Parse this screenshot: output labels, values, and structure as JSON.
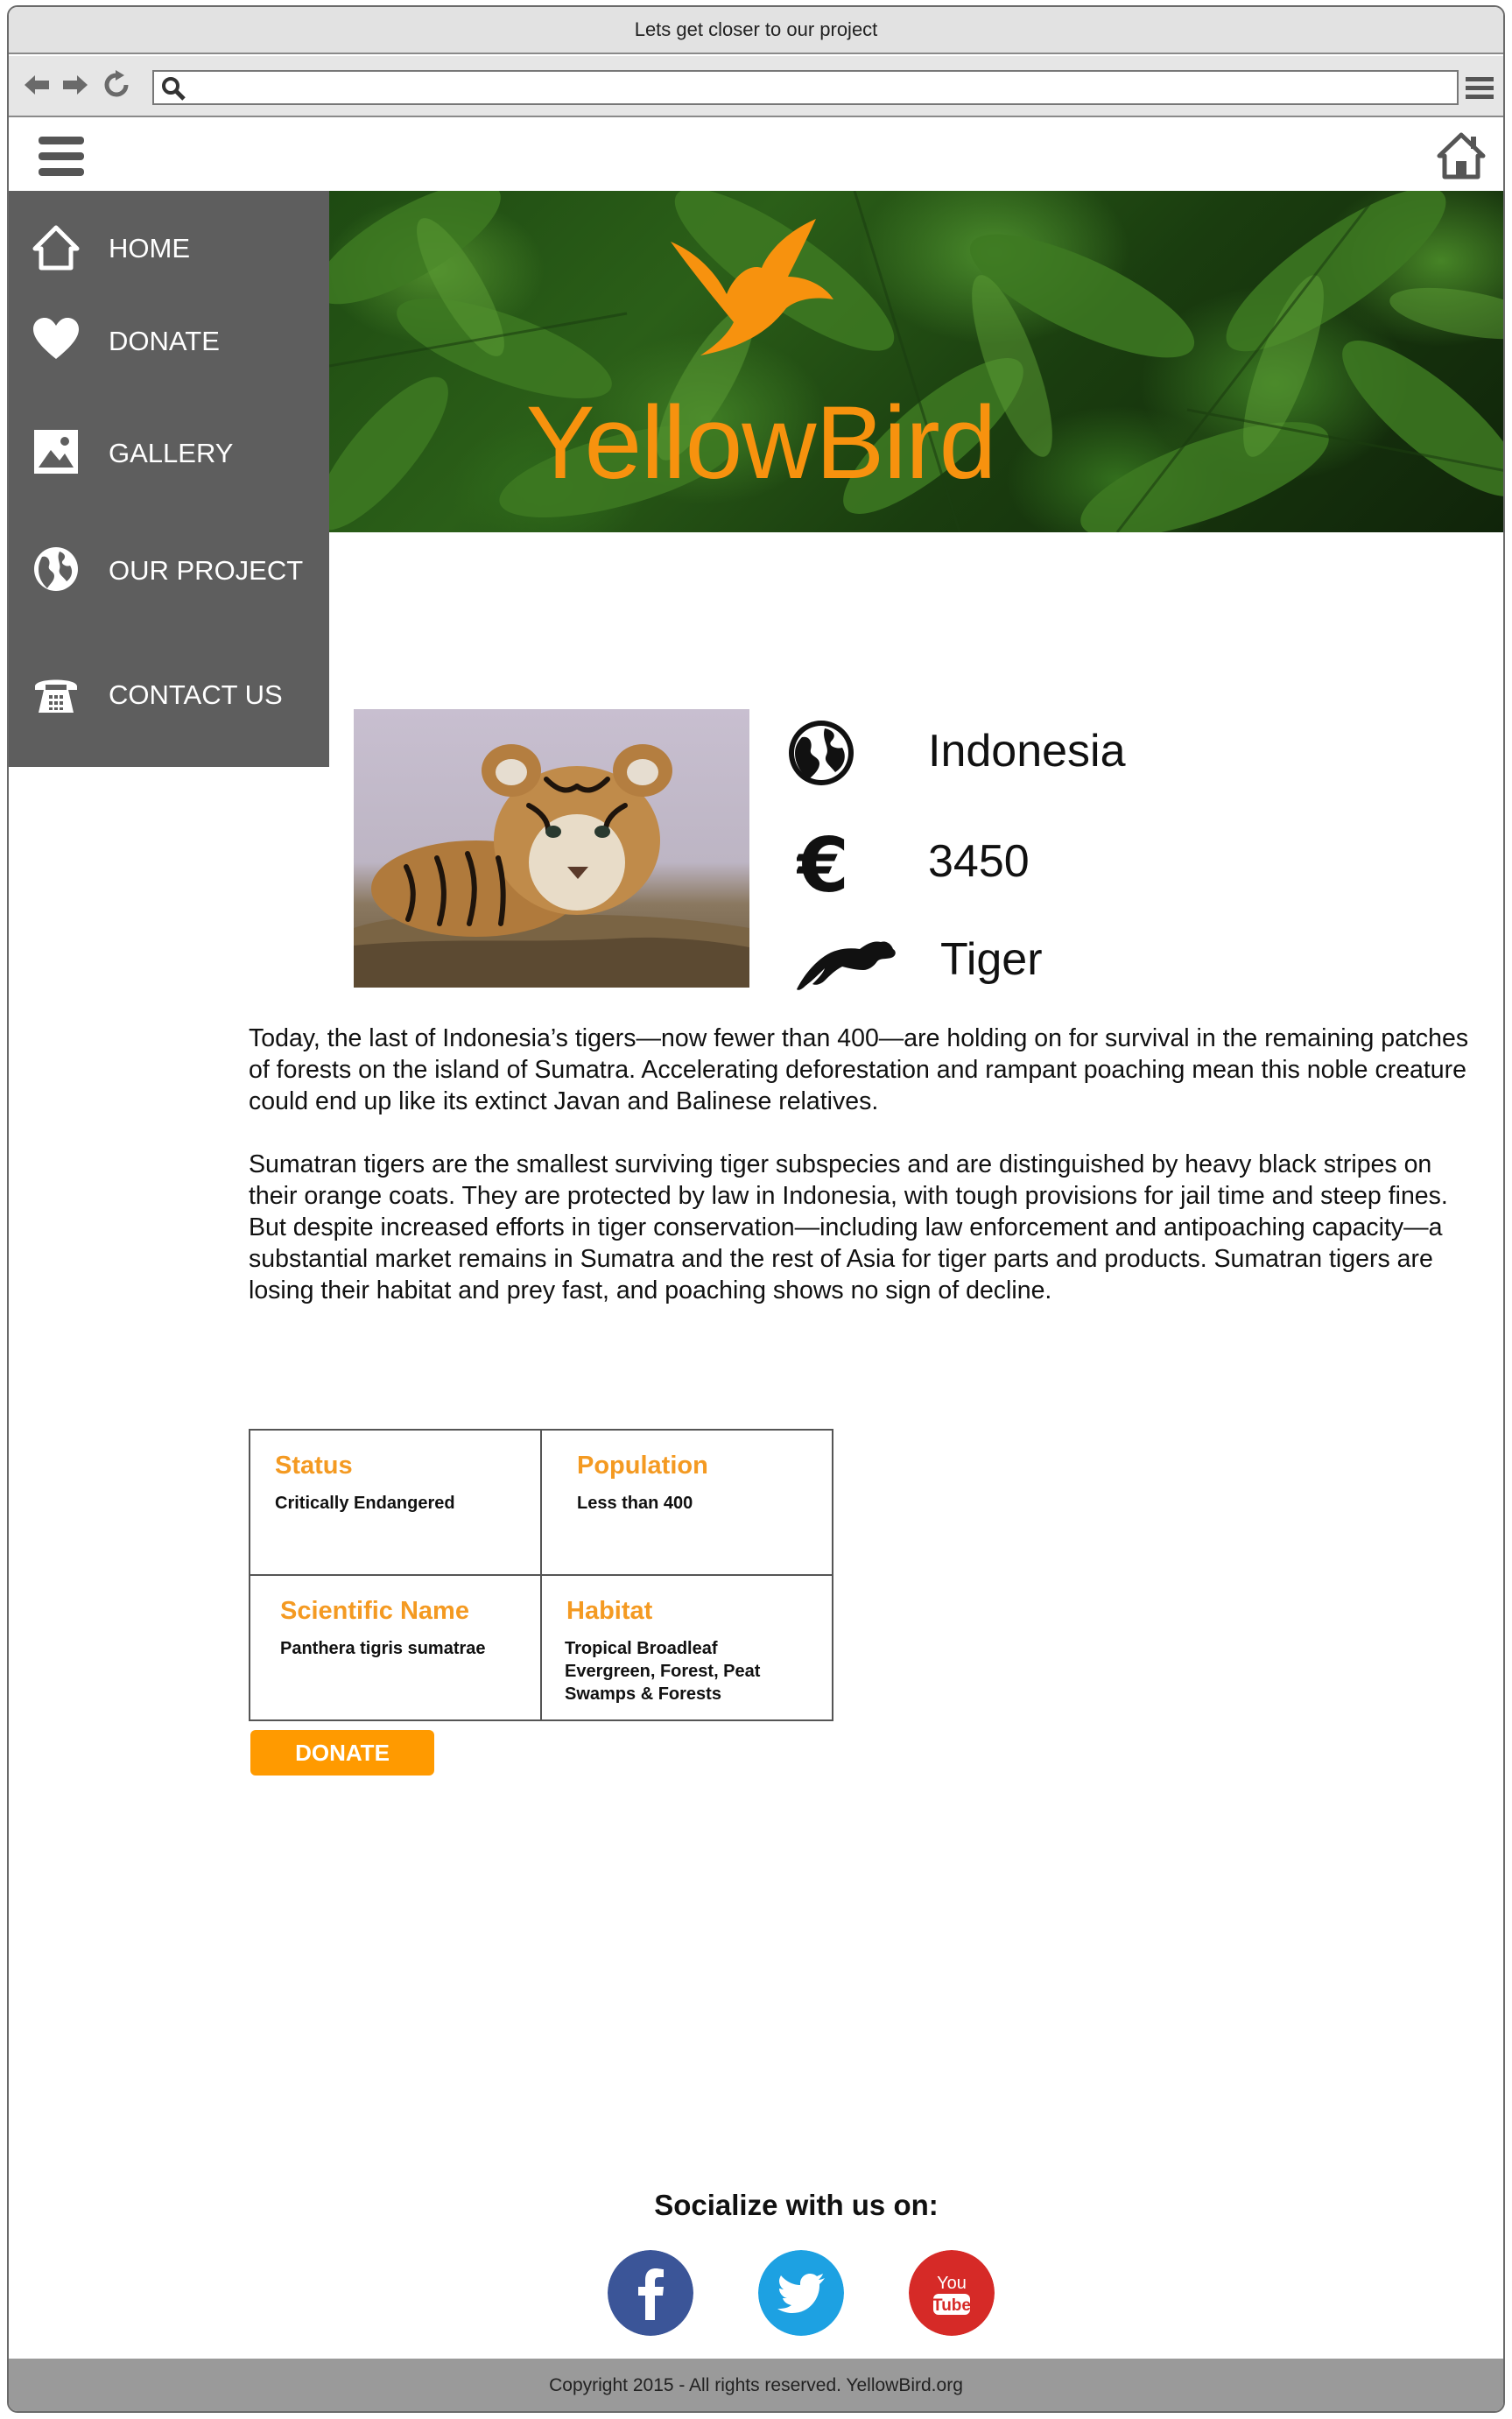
{
  "window": {
    "title": "Lets get closer to our project"
  },
  "browser": {
    "url_value": "",
    "url_placeholder": ""
  },
  "sidebar": {
    "items": [
      {
        "label": "HOME",
        "icon": "home-icon"
      },
      {
        "label": "DONATE",
        "icon": "heart-icon"
      },
      {
        "label": "GALLERY",
        "icon": "image-icon"
      },
      {
        "label": "OUR PROJECT",
        "icon": "globe-icon"
      },
      {
        "label": "CONTACT US",
        "icon": "phone-icon"
      }
    ]
  },
  "banner": {
    "brand": "YellowBird",
    "brand_color": "#f7920e"
  },
  "project": {
    "country": "Indonesia",
    "amount": "3450",
    "animal": "Tiger",
    "paragraphs": [
      "Today, the last of Indonesia’s tigers—now fewer than 400—are holding on for survival in the remaining patches of forests on the island of Sumatra. Accelerating deforestation and rampant poaching mean this noble creature could end up like its extinct Javan and Balinese relatives.",
      "Sumatran tigers are the smallest surviving tiger subspecies and are distinguished by heavy black stripes on their orange coats. They are protected by law in Indonesia, with tough provisions for jail time and steep fines. But despite increased efforts in tiger conservation—including law enforcement and antipoaching capacity—a substantial market remains in Sumatra and the rest of Asia for tiger parts and products. Sumatran tigers are losing their habitat and prey fast, and poaching shows no sign of decline."
    ]
  },
  "facts": {
    "status": {
      "title": "Status",
      "value": "Critically Endangered"
    },
    "population": {
      "title": "Population",
      "value": "Less than 400"
    },
    "scientific": {
      "title": "Scientific Name",
      "value": "Panthera tigris sumatrae"
    },
    "habitat": {
      "title": "Habitat",
      "value": "Tropical Broadleaf Evergreen, Forest, Peat Swamps & Forests"
    }
  },
  "donate_button": "DONATE",
  "social": {
    "title": "Socialize with us on:",
    "facebook_color": "#3b5598",
    "twitter_color": "#1da1e2",
    "youtube_color": "#d62a27"
  },
  "footer": {
    "text": "Copyright 2015  - All rights reserved. YellowBird.org"
  },
  "colors": {
    "accent": "#ff9a00",
    "sidebar": "#5e5e5e"
  }
}
